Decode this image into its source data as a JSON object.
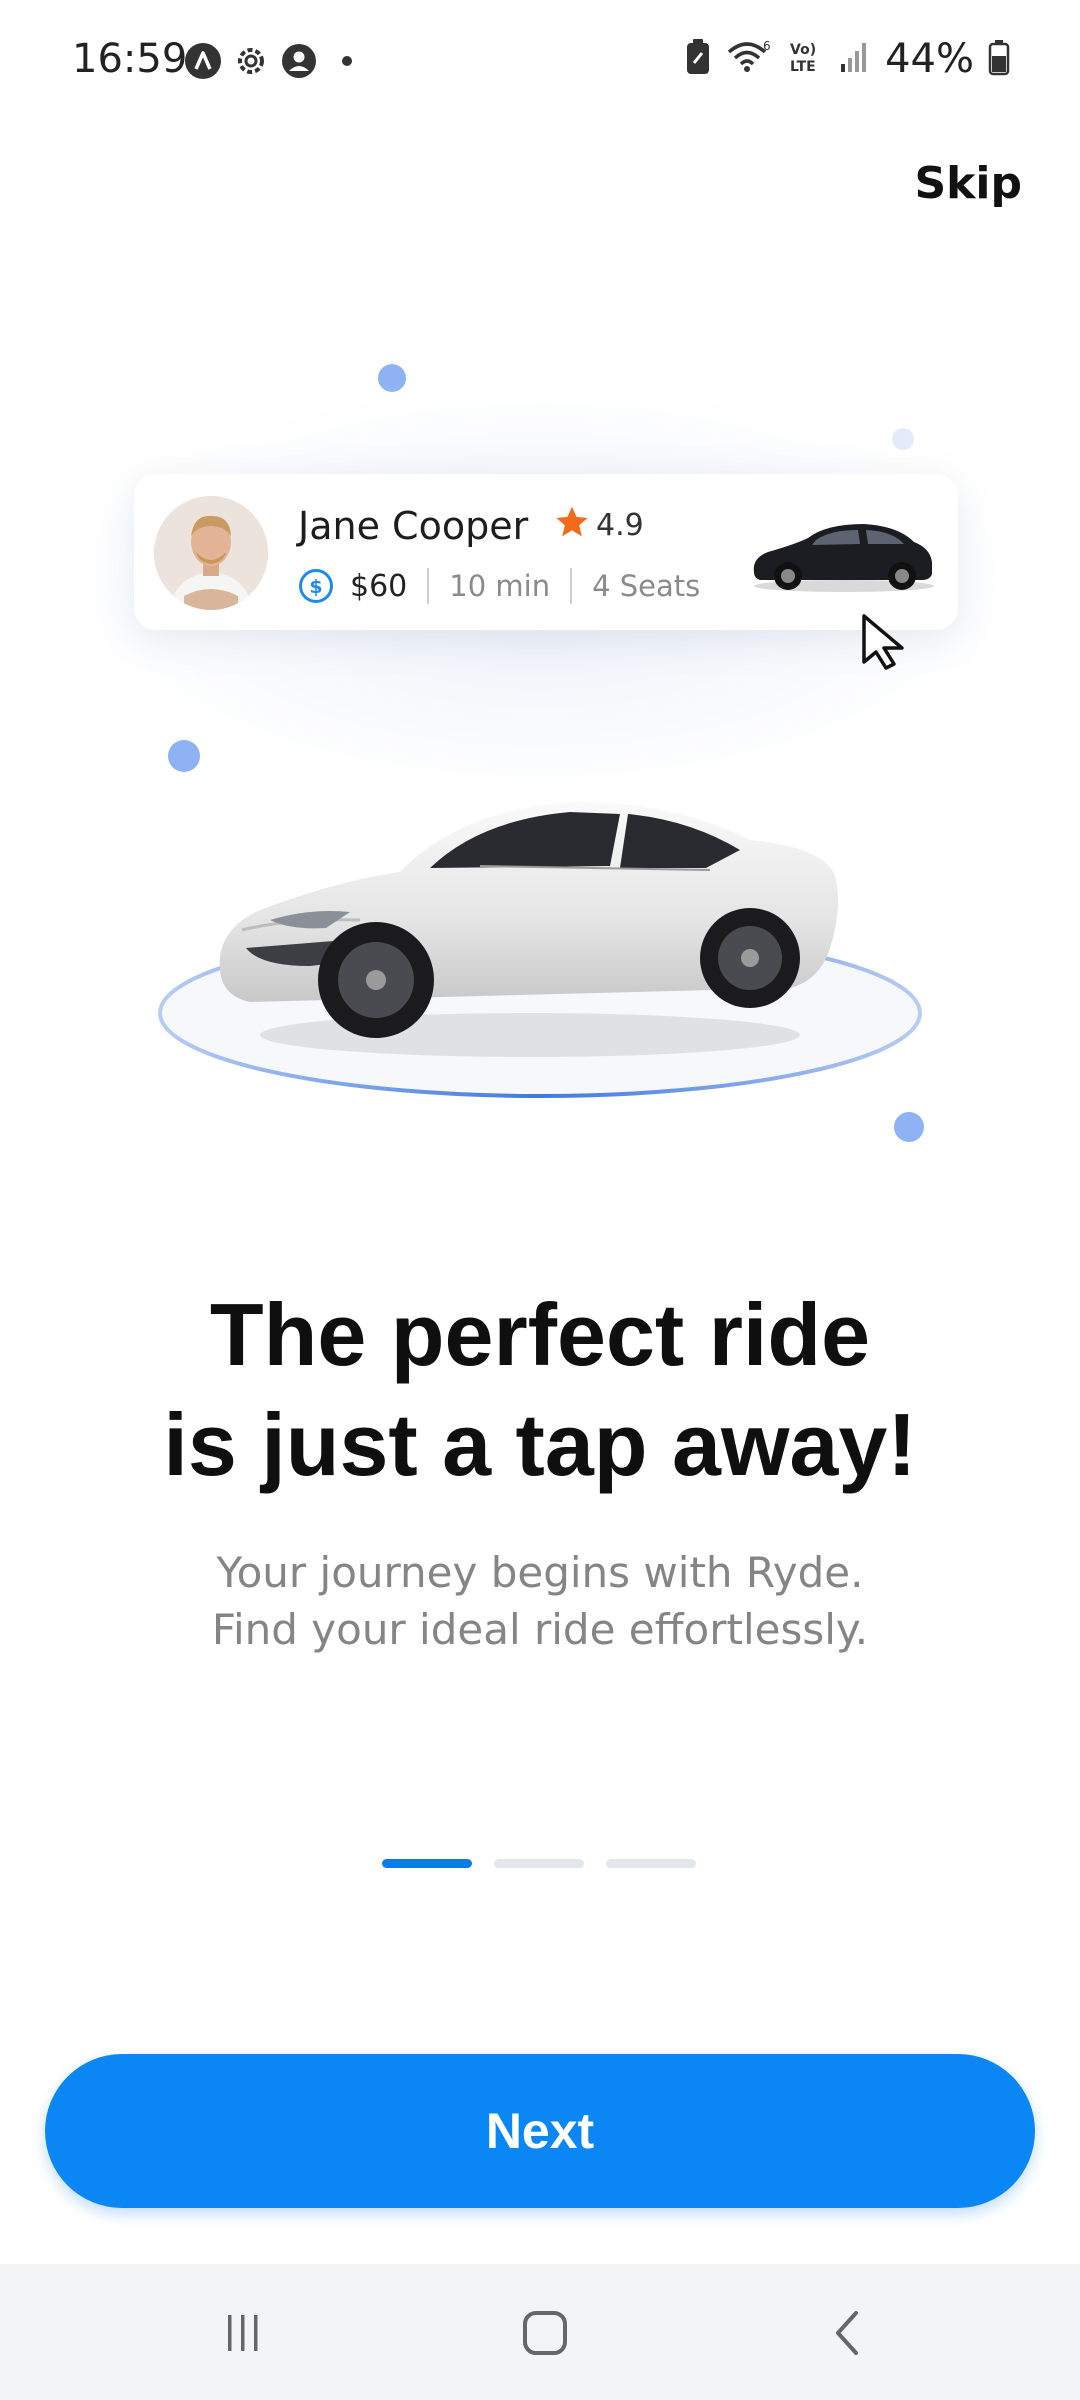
{
  "status_bar": {
    "time": "16:59",
    "battery": "44%",
    "icons_left": [
      "app-icon",
      "settings-icon",
      "account-icon",
      "dot-icon"
    ],
    "icons_right": [
      "battery-saver-icon",
      "wifi-icon",
      "volte-icon",
      "signal-icon",
      "battery-icon"
    ]
  },
  "header": {
    "skip_label": "Skip"
  },
  "driver_card": {
    "name": "Jane Cooper",
    "rating": "4.9",
    "price": "$60",
    "duration": "10 min",
    "seats": "4 Seats"
  },
  "headline": {
    "line1": "The perfect ride",
    "line2": "is just a tap away!"
  },
  "subtitle": {
    "line1": "Your journey begins with Ryde.",
    "line2": "Find your ideal ride effortlessly."
  },
  "pager": {
    "total": 3,
    "active": 1
  },
  "next_label": "Next",
  "colors": {
    "primary": "#0a87f5",
    "pager_active": "#0a7ce6",
    "pager_inactive": "#e3e6ec",
    "star": "#f26a1b",
    "dot_accent": "#8fb2f5"
  }
}
